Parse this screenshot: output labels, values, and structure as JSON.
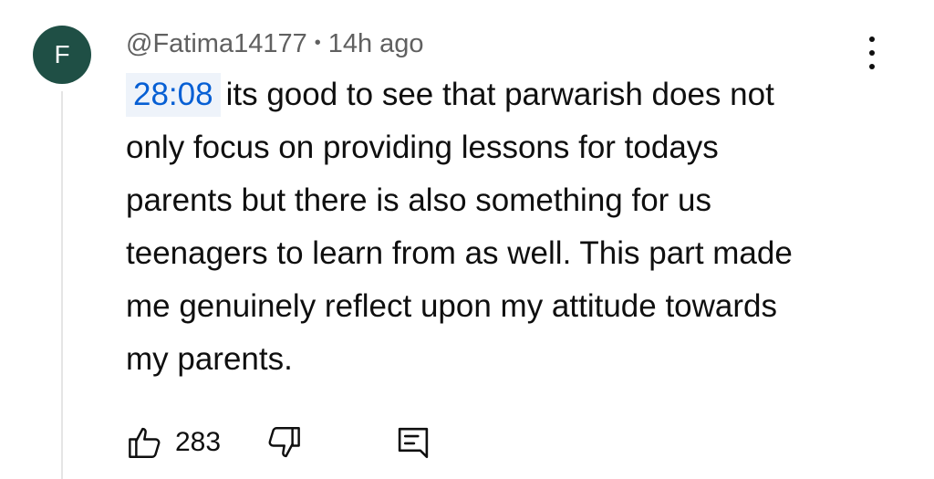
{
  "comment": {
    "avatar_letter": "F",
    "avatar_color": "#1f4f45",
    "author": "@Fatima14177",
    "separator": "•",
    "time_ago": "14h ago",
    "timestamp_link": "28:08",
    "text": "its good to see that parwarish does not only focus on providing lessons for todays parents but there is also something for us teenagers to learn from as well. This part made me genuinely reflect upon my attitude towards my parents.",
    "like_count": "283",
    "icons": {
      "like": "thumbs-up-icon",
      "dislike": "thumbs-down-icon",
      "reply": "reply-comment-icon",
      "more": "more-vertical-icon"
    }
  },
  "colors": {
    "link": "#065fd4",
    "link_bg": "#eef3fa",
    "meta_text": "#606060",
    "body_text": "#0f0f0f"
  }
}
